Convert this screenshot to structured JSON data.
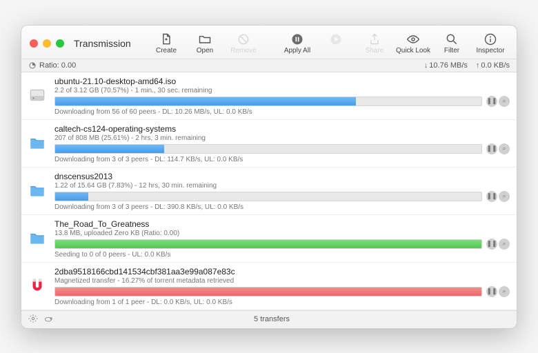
{
  "app": {
    "title": "Transmission"
  },
  "toolbar": {
    "create": "Create",
    "open": "Open",
    "remove": "Remove",
    "apply_all": "Apply All",
    "share": "Share",
    "quick_look": "Quick Look",
    "filter": "Filter",
    "inspector": "Inspector"
  },
  "status": {
    "ratio_label": "Ratio: 0.00",
    "dl_speed": "10.76 MB/s",
    "ul_speed": "0.0 KB/s"
  },
  "torrents": [
    {
      "name": "ubuntu-21.10-desktop-amd64.iso",
      "line1": "2.2 of 3.12 GB (70.57%) - 1 min., 30 sec. remaining",
      "line2": "Downloading from 56 of 60 peers - DL: 10.26 MB/s, UL: 0.0 KB/s",
      "percent": 70.57,
      "color": "blue",
      "icon": "disk"
    },
    {
      "name": "caltech-cs124-operating-systems",
      "line1": "207 of 808 MB (25.61%) - 2 hrs, 3 min. remaining",
      "line2": "Downloading from 3 of 3 peers - DL: 114.7 KB/s, UL: 0.0 KB/s",
      "percent": 25.61,
      "color": "blue",
      "icon": "folder"
    },
    {
      "name": "dnscensus2013",
      "line1": "1.22 of 15.64 GB (7.83%) - 12 hrs, 30 min. remaining",
      "line2": "Downloading from 3 of 3 peers - DL: 390.8 KB/s, UL: 0.0 KB/s",
      "percent": 7.83,
      "color": "blue",
      "icon": "folder"
    },
    {
      "name": "The_Road_To_Greatness",
      "line1": "13.8 MB, uploaded Zero KB (Ratio: 0.00)",
      "line2": "Seeding to 0 of 0 peers - UL: 0.0 KB/s",
      "percent": 100,
      "color": "green",
      "icon": "folder"
    },
    {
      "name": "2dba9518166cbd141534cbf381aa3e99a087e83c",
      "line1": "Magnetized transfer - 16.27% of torrent metadata retrieved",
      "line2": "Downloading from 1 of 1 peer - DL: 0.0 KB/s, UL: 0.0 KB/s",
      "percent": 100,
      "color": "red",
      "icon": "magnet"
    }
  ],
  "footer": {
    "count": "5 transfers"
  }
}
